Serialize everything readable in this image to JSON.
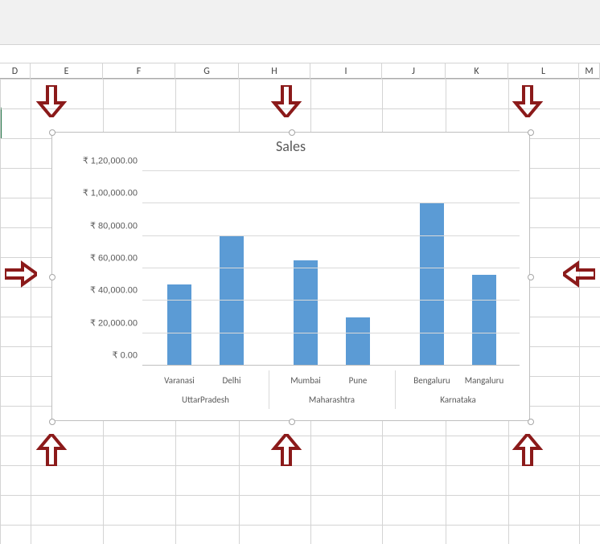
{
  "columns": [
    "D",
    "E",
    "F",
    "G",
    "H",
    "I",
    "J",
    "K",
    "L",
    "M"
  ],
  "chart": {
    "title": "Sales"
  },
  "chart_data": {
    "type": "bar",
    "title": "Sales",
    "xlabel": "",
    "ylabel": "",
    "ylim": [
      0,
      120000
    ],
    "y_ticks": [
      "₹ 0.00",
      "₹ 20,000.00",
      "₹ 40,000.00",
      "₹ 60,000.00",
      "₹ 80,000.00",
      "₹ 1,00,000.00",
      "₹ 1,20,000.00"
    ],
    "groups": [
      {
        "name": "UttarPradesh",
        "items": [
          "Varanasi",
          "Delhi"
        ]
      },
      {
        "name": "Maharashtra",
        "items": [
          "Mumbai",
          "Pune"
        ]
      },
      {
        "name": "Karnataka",
        "items": [
          "Bengaluru",
          "Mangaluru"
        ]
      }
    ],
    "categories": [
      "Varanasi",
      "Delhi",
      "Mumbai",
      "Pune",
      "Bengaluru",
      "Mangaluru"
    ],
    "values": [
      50000,
      80000,
      65000,
      30000,
      100000,
      56000
    ]
  }
}
